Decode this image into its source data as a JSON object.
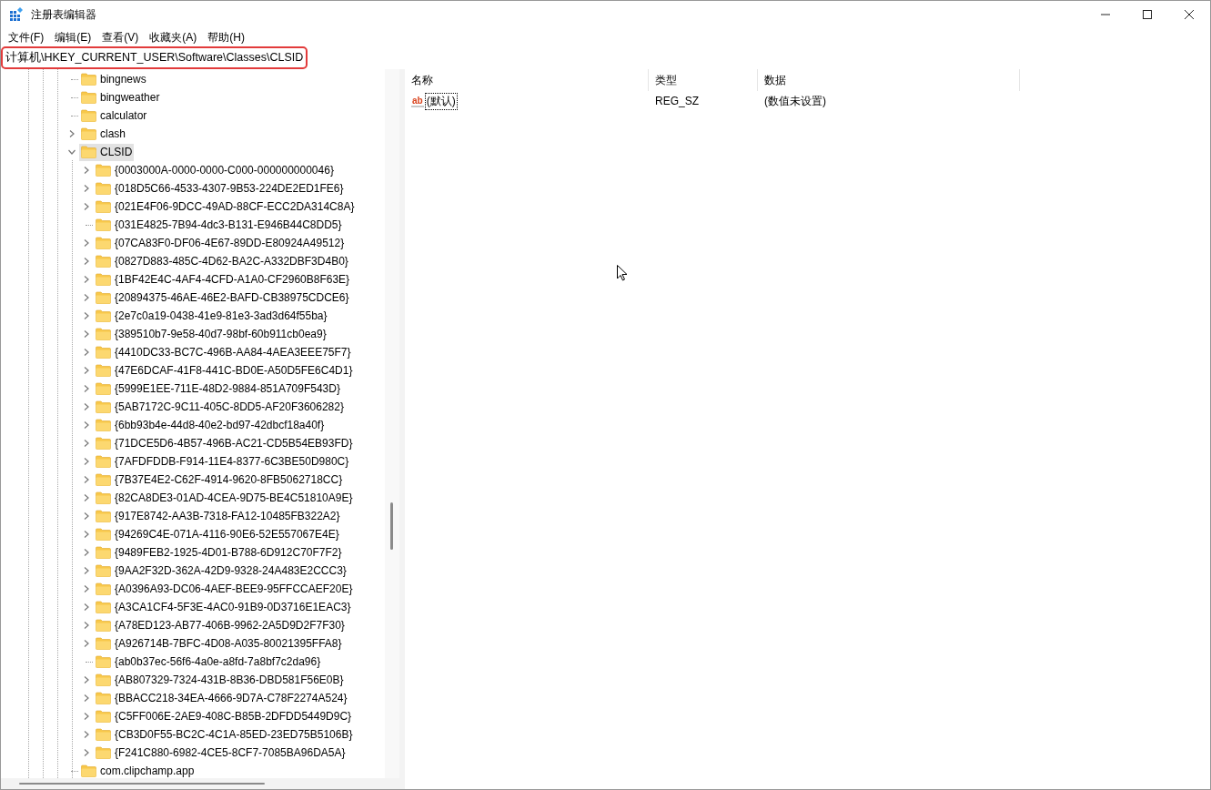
{
  "window": {
    "title": "注册表编辑器"
  },
  "menu": [
    "文件(F)",
    "编辑(E)",
    "查看(V)",
    "收藏夹(A)",
    "帮助(H)"
  ],
  "address": "计算机\\HKEY_CURRENT_USER\\Software\\Classes\\CLSID",
  "tree": [
    {
      "label": "bingnews",
      "expandable": false,
      "expanded": false,
      "selected": false
    },
    {
      "label": "bingweather",
      "expandable": false,
      "expanded": false,
      "selected": false
    },
    {
      "label": "calculator",
      "expandable": false,
      "expanded": false,
      "selected": false
    },
    {
      "label": "clash",
      "expandable": true,
      "expanded": false,
      "selected": false
    },
    {
      "label": "CLSID",
      "expandable": true,
      "expanded": true,
      "selected": true,
      "children": [
        {
          "label": "{0003000A-0000-0000-C000-000000000046}",
          "expandable": true,
          "expanded": false,
          "selected": false
        },
        {
          "label": "{018D5C66-4533-4307-9B53-224DE2ED1FE6}",
          "expandable": true,
          "expanded": false,
          "selected": false
        },
        {
          "label": "{021E4F06-9DCC-49AD-88CF-ECC2DA314C8A}",
          "expandable": true,
          "expanded": false,
          "selected": false
        },
        {
          "label": "{031E4825-7B94-4dc3-B131-E946B44C8DD5}",
          "expandable": false,
          "expanded": false,
          "selected": false
        },
        {
          "label": "{07CA83F0-DF06-4E67-89DD-E80924A49512}",
          "expandable": true,
          "expanded": false,
          "selected": false
        },
        {
          "label": "{0827D883-485C-4D62-BA2C-A332DBF3D4B0}",
          "expandable": true,
          "expanded": false,
          "selected": false
        },
        {
          "label": "{1BF42E4C-4AF4-4CFD-A1A0-CF2960B8F63E}",
          "expandable": true,
          "expanded": false,
          "selected": false
        },
        {
          "label": "{20894375-46AE-46E2-BAFD-CB38975CDCE6}",
          "expandable": true,
          "expanded": false,
          "selected": false
        },
        {
          "label": "{2e7c0a19-0438-41e9-81e3-3ad3d64f55ba}",
          "expandable": true,
          "expanded": false,
          "selected": false
        },
        {
          "label": "{389510b7-9e58-40d7-98bf-60b911cb0ea9}",
          "expandable": true,
          "expanded": false,
          "selected": false
        },
        {
          "label": "{4410DC33-BC7C-496B-AA84-4AEA3EEE75F7}",
          "expandable": true,
          "expanded": false,
          "selected": false
        },
        {
          "label": "{47E6DCAF-41F8-441C-BD0E-A50D5FE6C4D1}",
          "expandable": true,
          "expanded": false,
          "selected": false
        },
        {
          "label": "{5999E1EE-711E-48D2-9884-851A709F543D}",
          "expandable": true,
          "expanded": false,
          "selected": false
        },
        {
          "label": "{5AB7172C-9C11-405C-8DD5-AF20F3606282}",
          "expandable": true,
          "expanded": false,
          "selected": false
        },
        {
          "label": "{6bb93b4e-44d8-40e2-bd97-42dbcf18a40f}",
          "expandable": true,
          "expanded": false,
          "selected": false
        },
        {
          "label": "{71DCE5D6-4B57-496B-AC21-CD5B54EB93FD}",
          "expandable": true,
          "expanded": false,
          "selected": false
        },
        {
          "label": "{7AFDFDDB-F914-11E4-8377-6C3BE50D980C}",
          "expandable": true,
          "expanded": false,
          "selected": false
        },
        {
          "label": "{7B37E4E2-C62F-4914-9620-8FB5062718CC}",
          "expandable": true,
          "expanded": false,
          "selected": false
        },
        {
          "label": "{82CA8DE3-01AD-4CEA-9D75-BE4C51810A9E}",
          "expandable": true,
          "expanded": false,
          "selected": false
        },
        {
          "label": "{917E8742-AA3B-7318-FA12-10485FB322A2}",
          "expandable": true,
          "expanded": false,
          "selected": false
        },
        {
          "label": "{94269C4E-071A-4116-90E6-52E557067E4E}",
          "expandable": true,
          "expanded": false,
          "selected": false
        },
        {
          "label": "{9489FEB2-1925-4D01-B788-6D912C70F7F2}",
          "expandable": true,
          "expanded": false,
          "selected": false
        },
        {
          "label": "{9AA2F32D-362A-42D9-9328-24A483E2CCC3}",
          "expandable": true,
          "expanded": false,
          "selected": false
        },
        {
          "label": "{A0396A93-DC06-4AEF-BEE9-95FFCCAEF20E}",
          "expandable": true,
          "expanded": false,
          "selected": false
        },
        {
          "label": "{A3CA1CF4-5F3E-4AC0-91B9-0D3716E1EAC3}",
          "expandable": true,
          "expanded": false,
          "selected": false
        },
        {
          "label": "{A78ED123-AB77-406B-9962-2A5D9D2F7F30}",
          "expandable": true,
          "expanded": false,
          "selected": false
        },
        {
          "label": "{A926714B-7BFC-4D08-A035-80021395FFA8}",
          "expandable": true,
          "expanded": false,
          "selected": false
        },
        {
          "label": "{ab0b37ec-56f6-4a0e-a8fd-7a8bf7c2da96}",
          "expandable": false,
          "expanded": false,
          "selected": false
        },
        {
          "label": "{AB807329-7324-431B-8B36-DBD581F56E0B}",
          "expandable": true,
          "expanded": false,
          "selected": false
        },
        {
          "label": "{BBACC218-34EA-4666-9D7A-C78F2274A524}",
          "expandable": true,
          "expanded": false,
          "selected": false
        },
        {
          "label": "{C5FF006E-2AE9-408C-B85B-2DFDD5449D9C}",
          "expandable": true,
          "expanded": false,
          "selected": false
        },
        {
          "label": "{CB3D0F55-BC2C-4C1A-85ED-23ED75B5106B}",
          "expandable": true,
          "expanded": false,
          "selected": false
        },
        {
          "label": "{F241C880-6982-4CE5-8CF7-7085BA96DA5A}",
          "expandable": true,
          "expanded": false,
          "selected": false
        }
      ]
    },
    {
      "label": "com.clipchamp.app",
      "expandable": false,
      "expanded": false,
      "selected": false
    }
  ],
  "columns": [
    "名称",
    "类型",
    "数据"
  ],
  "values": [
    {
      "icon_text": "ab",
      "name": "(默认)",
      "type": "REG_SZ",
      "data": "(数值未设置)"
    }
  ]
}
